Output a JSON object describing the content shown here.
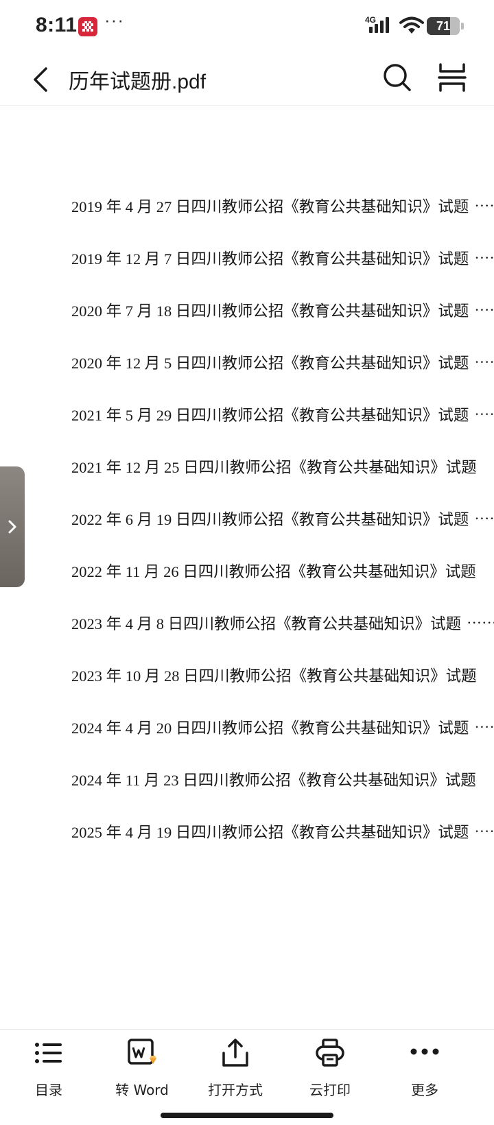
{
  "status_bar": {
    "time": "8:11",
    "dots": "···",
    "network": "4G",
    "battery_level": "71",
    "battery_fraction": 0.71,
    "app_badge_color": "#d6283a"
  },
  "header": {
    "title": "历年试题册.pdf",
    "back_icon": "chevron-left-icon",
    "search_icon": "search-icon",
    "mode_icon": "reading-mode-icon"
  },
  "toc": {
    "items": [
      {
        "text": "2019 年 4 月 27 日四川教师公招《教育公共基础知识》试题",
        "leader": "·························"
      },
      {
        "text": "2019 年 12 月 7 日四川教师公招《教育公共基础知识》试题",
        "leader": "·························"
      },
      {
        "text": "2020 年 7 月 18 日四川教师公招《教育公共基础知识》试题",
        "leader": "·························"
      },
      {
        "text": "2020 年 12 月 5 日四川教师公招《教育公共基础知识》试题",
        "leader": "·························"
      },
      {
        "text": "2021 年 5 月 29 日四川教师公招《教育公共基础知识》试题",
        "leader": "·························"
      },
      {
        "text": "2021 年 12 月 25 日四川教师公招《教育公共基础知识》试题",
        "leader": ""
      },
      {
        "text": "2022 年 6 月 19 日四川教师公招《教育公共基础知识》试题",
        "leader": "·························"
      },
      {
        "text": "2022 年 11 月 26 日四川教师公招《教育公共基础知识》试题",
        "leader": ""
      },
      {
        "text": "2023 年 4 月 8 日四川教师公招《教育公共基础知识》试题",
        "leader": "·························"
      },
      {
        "text": "2023 年 10 月 28 日四川教师公招《教育公共基础知识》试题",
        "leader": ""
      },
      {
        "text": "2024 年 4 月 20 日四川教师公招《教育公共基础知识》试题",
        "leader": "·························"
      },
      {
        "text": "2024 年 11 月 23 日四川教师公招《教育公共基础知识》试题",
        "leader": ""
      },
      {
        "text": "2025 年 4 月 19 日四川教师公招《教育公共基础知识》试题",
        "leader": "·························"
      }
    ]
  },
  "side_tab": {
    "icon": "chevron-right-icon"
  },
  "toolbar": {
    "items": [
      {
        "label": "目录",
        "icon": "list-icon"
      },
      {
        "label": "转 Word",
        "icon": "image-word-convert-icon"
      },
      {
        "label": "打开方式",
        "icon": "share-upload-icon"
      },
      {
        "label": "云打印",
        "icon": "printer-icon"
      },
      {
        "label": "更多",
        "icon": "more-dots-icon"
      }
    ]
  }
}
